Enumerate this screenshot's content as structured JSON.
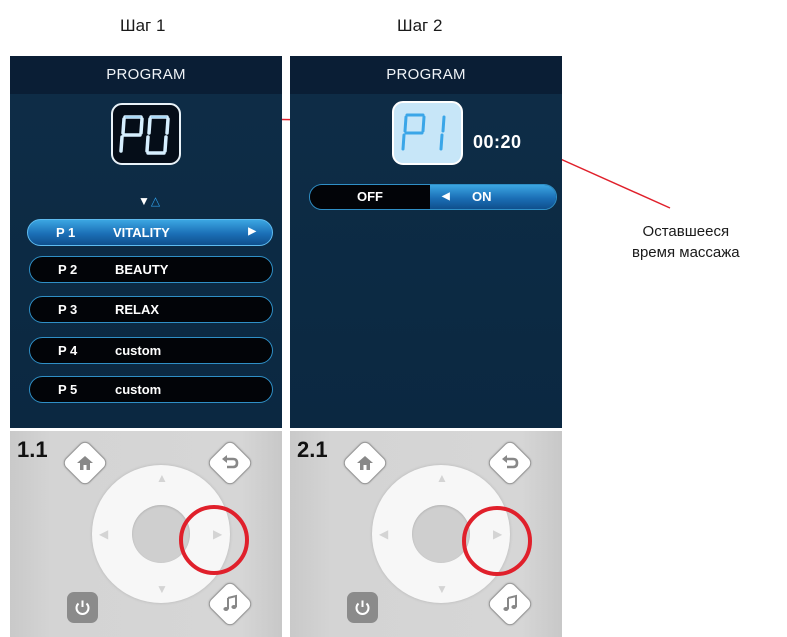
{
  "steps": [
    {
      "label": "Шаг 1",
      "remote_tag": "1.1"
    },
    {
      "label": "Шаг 2",
      "remote_tag": "2.1"
    }
  ],
  "screen1": {
    "header": "PROGRAM",
    "display_code": "P0",
    "programs": [
      {
        "num": "P 1",
        "name": "VITALITY",
        "selected": true
      },
      {
        "num": "P 2",
        "name": "BEAUTY",
        "selected": false
      },
      {
        "num": "P 3",
        "name": "RELAX",
        "selected": false
      },
      {
        "num": "P 4",
        "name": "custom",
        "selected": false
      },
      {
        "num": "P 5",
        "name": "custom",
        "selected": false
      }
    ],
    "scroll_icons": "down-up-triangles"
  },
  "screen2": {
    "header": "PROGRAM",
    "display_code": "P1",
    "time": "00:20",
    "toggle": {
      "off_label": "OFF",
      "on_label": "ON",
      "state": "ON"
    }
  },
  "callout": {
    "line1": "Оставшееся",
    "line2": "время массажа"
  },
  "colors": {
    "accent": "#e0202b",
    "screen_bg": "#0b2841",
    "selected": "#1b6fb6"
  },
  "icons": [
    "home-icon",
    "back-arrow-icon",
    "music-note-icon",
    "power-icon"
  ]
}
